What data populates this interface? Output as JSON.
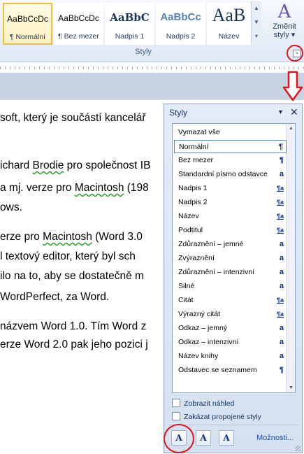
{
  "ribbon": {
    "gallery": [
      {
        "sample": "AaBbCcDc",
        "label": "¶ Normální",
        "active": true
      },
      {
        "sample": "AaBbCcDc",
        "label": "¶ Bez mezer",
        "active": false
      },
      {
        "sample": "AaBbC",
        "label": "Nadpis 1",
        "active": false
      },
      {
        "sample": "AaBbCc",
        "label": "Nadpis 2",
        "active": false
      },
      {
        "sample": "AaB",
        "label": "Název",
        "active": false
      }
    ],
    "change_styles": {
      "icon": "A",
      "label_line1": "Změnit",
      "label_line2": "styly ▾"
    },
    "group_label": "Styly",
    "dialog_launcher": "↘"
  },
  "document": {
    "lines": [
      {
        "segments": [
          {
            "t": "soft, který je součástí kancelář"
          }
        ]
      },
      {
        "segments": [
          {
            "t": "ichard "
          },
          {
            "t": "Brodie",
            "sq": true
          },
          {
            "t": " pro společnost  IB"
          }
        ]
      },
      {
        "segments": [
          {
            "t": "a  mj. verze pro "
          },
          {
            "t": "Macintosh",
            "sq": true
          },
          {
            "t": "  (198"
          }
        ]
      },
      {
        "segments": [
          {
            "t": "ows."
          }
        ]
      },
      {
        "segments": [
          {
            "t": "erze pro "
          },
          {
            "t": "Macintosh",
            "sq": true
          },
          {
            "t": "  (Word 3.0"
          }
        ]
      },
      {
        "segments": [
          {
            "t": "l textový editor, který byl sch"
          }
        ]
      },
      {
        "segments": [
          {
            "t": "ilo  na to, aby se dostatečně  m"
          }
        ]
      },
      {
        "segments": [
          {
            "t": " WordPerfect, za Word."
          }
        ]
      },
      {
        "segments": [
          {
            "t": " názvem Word 1.0. Tím Word z"
          }
        ]
      },
      {
        "segments": [
          {
            "t": "erze Word 2.0 pak jeho pozici j"
          }
        ]
      }
    ]
  },
  "pane": {
    "title": "Styly",
    "menu_glyph": "▼",
    "close_glyph": "✕",
    "items": [
      {
        "name": "Vymazat vše",
        "mark": ""
      },
      {
        "name": "Normální",
        "mark": "¶",
        "selected": true
      },
      {
        "name": "Bez mezer",
        "mark": "¶"
      },
      {
        "name": "Standardní písmo odstavce",
        "mark": "a"
      },
      {
        "name": "Nadpis 1",
        "mark": "¶a"
      },
      {
        "name": "Nadpis 2",
        "mark": "¶a"
      },
      {
        "name": "Název",
        "mark": "¶a"
      },
      {
        "name": "Podtitul",
        "mark": "¶a"
      },
      {
        "name": "Zdůraznění – jemné",
        "mark": "a"
      },
      {
        "name": "Zvýraznění",
        "mark": "a"
      },
      {
        "name": "Zdůraznění – intenzivní",
        "mark": "a"
      },
      {
        "name": "Silné",
        "mark": "a"
      },
      {
        "name": "Citát",
        "mark": "¶a"
      },
      {
        "name": "Výrazný citát",
        "mark": "¶a"
      },
      {
        "name": "Odkaz – jemný",
        "mark": "a"
      },
      {
        "name": "Odkaz – intenzivní",
        "mark": "a"
      },
      {
        "name": "Název knihy",
        "mark": "a"
      },
      {
        "name": "Odstavec se seznamem",
        "mark": "¶"
      }
    ],
    "show_preview": "Zobrazit náhled",
    "disable_linked": "Zakázat propojené styly",
    "buttons": [
      {
        "glyph": "A",
        "name": "new-style-button"
      },
      {
        "glyph": "A",
        "name": "style-inspector-button"
      },
      {
        "glyph": "A",
        "name": "manage-styles-button"
      }
    ],
    "options_link": "Možnosti..."
  },
  "colors": {
    "annotation_red": "#e0141c",
    "pane_bg": "#d5e1f0",
    "link": "#1550b8"
  }
}
